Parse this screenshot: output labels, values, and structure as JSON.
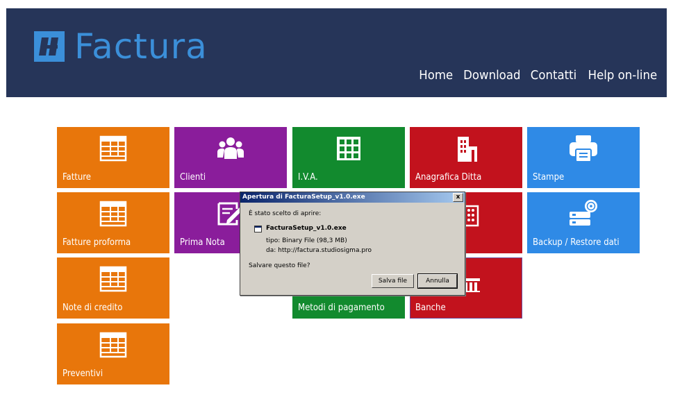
{
  "app": {
    "logo_text": "Factura",
    "logo_color": "#3b8fd9",
    "header_bg": "#263559"
  },
  "nav": [
    "Home",
    "Download",
    "Contatti",
    "Help on-line"
  ],
  "tiles": {
    "fatture": {
      "label": "Fatture",
      "icon": "table-icon"
    },
    "fatture_proforma": {
      "label": "Fatture proforma",
      "icon": "table-icon"
    },
    "note_credito": {
      "label": "Note di credito",
      "icon": "table-icon"
    },
    "preventivi": {
      "label": "Preventivi",
      "icon": "table-icon"
    },
    "clienti": {
      "label": "Clienti",
      "icon": "users-icon"
    },
    "prima_nota": {
      "label": "Prima Nota",
      "icon": "edit-icon"
    },
    "iva": {
      "label": "I.V.A.",
      "icon": "grid-icon"
    },
    "metodi_pagamento": {
      "label": "Metodi di pagamento",
      "icon": "payment-icon"
    },
    "anagrafica_ditta": {
      "label": "Anagrafica Ditta",
      "icon": "building-icon"
    },
    "banche": {
      "label": "Banche",
      "icon": "bank-icon"
    },
    "stampe": {
      "label": "Stampe",
      "icon": "printer-icon"
    },
    "backup": {
      "label": "Backup / Restore dati",
      "icon": "backup-icon"
    }
  },
  "colors": {
    "orange": "#e8760b",
    "purple": "#8a1d9b",
    "green": "#128a2e",
    "red": "#c2121d",
    "blue": "#2f8ae6"
  },
  "dialog": {
    "title": "Apertura di FacturaSetup_v1.0.exe",
    "close_label": "x",
    "intro": "È stato scelto di aprire:",
    "filename": "FacturaSetup_v1.0.exe",
    "type_text": "tipo:  Binary File (98,3 MB)",
    "from_text": "da:  http://factura.studiosigma.pro",
    "question": "Salvare questo file?",
    "save_label": "Salva file",
    "cancel_label": "Annulla"
  }
}
